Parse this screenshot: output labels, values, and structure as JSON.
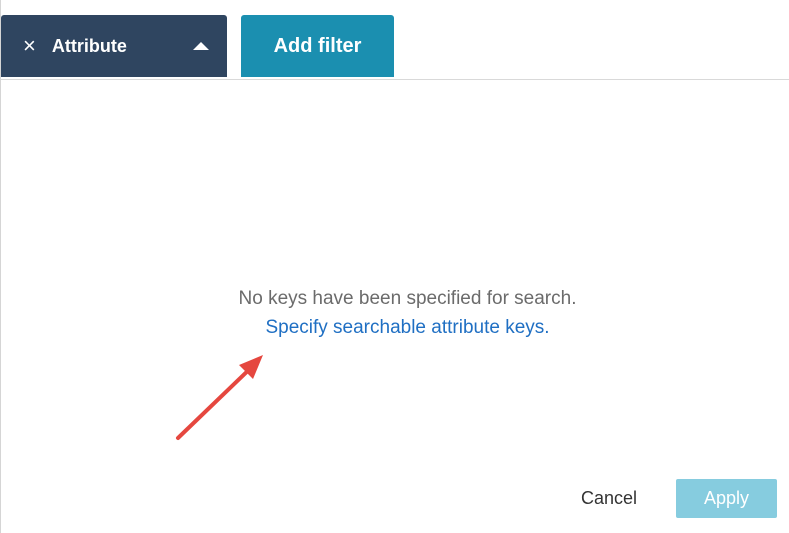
{
  "toolbar": {
    "attribute_chip_label": "Attribute",
    "close_glyph": "×",
    "add_filter_label": "Add filter"
  },
  "panel": {
    "empty_message": "No keys have been specified for search.",
    "specify_link": "Specify searchable attribute keys."
  },
  "footer": {
    "cancel_label": "Cancel",
    "apply_label": "Apply"
  },
  "colors": {
    "chip_bg": "#2f4560",
    "add_filter_bg": "#1b8fb0",
    "link": "#1f6fc3",
    "apply_disabled_bg": "#86ccdf",
    "annotation_arrow": "#e5473f"
  },
  "icons": {
    "close": "close-icon",
    "caret": "caret-up-icon"
  }
}
